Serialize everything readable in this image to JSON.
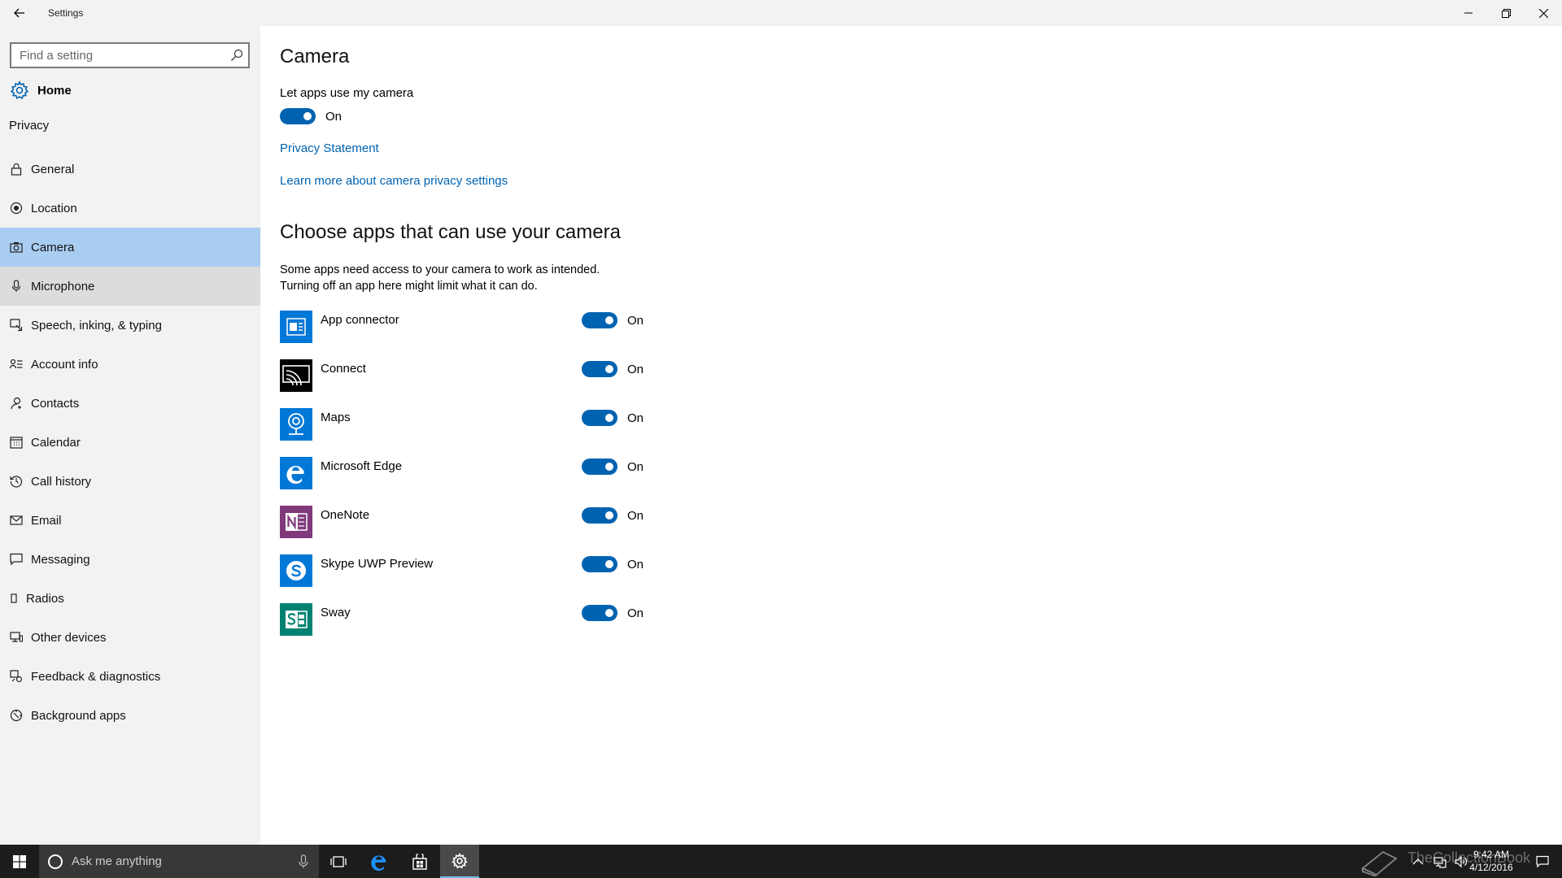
{
  "window": {
    "title": "Settings"
  },
  "sidebar": {
    "search_placeholder": "Find a setting",
    "home_label": "Home",
    "section_label": "Privacy",
    "items": [
      {
        "label": "General",
        "icon": "lock-icon"
      },
      {
        "label": "Location",
        "icon": "location-icon"
      },
      {
        "label": "Camera",
        "icon": "camera-icon",
        "state": "selected"
      },
      {
        "label": "Microphone",
        "icon": "microphone-icon",
        "state": "hover"
      },
      {
        "label": "Speech, inking, & typing",
        "icon": "speech-icon"
      },
      {
        "label": "Account info",
        "icon": "account-info-icon"
      },
      {
        "label": "Contacts",
        "icon": "contacts-icon"
      },
      {
        "label": "Calendar",
        "icon": "calendar-icon"
      },
      {
        "label": "Call history",
        "icon": "history-icon"
      },
      {
        "label": "Email",
        "icon": "email-icon"
      },
      {
        "label": "Messaging",
        "icon": "messaging-icon"
      },
      {
        "label": "Radios",
        "icon": "radios-icon"
      },
      {
        "label": "Other devices",
        "icon": "devices-icon"
      },
      {
        "label": "Feedback & diagnostics",
        "icon": "feedback-icon"
      },
      {
        "label": "Background apps",
        "icon": "background-apps-icon"
      }
    ]
  },
  "main": {
    "title": "Camera",
    "master_toggle": {
      "label": "Let apps use my camera",
      "state": "On"
    },
    "privacy_link": "Privacy Statement",
    "learn_link": "Learn more about camera privacy settings",
    "apps_heading": "Choose apps that can use your camera",
    "description_line1": "Some apps need access to your camera to work as intended.",
    "description_line2": "Turning off an app here might limit what it can do.",
    "apps": [
      {
        "name": "App connector",
        "state": "On",
        "color": "#0078d7",
        "icon": "app-connector-icon"
      },
      {
        "name": "Connect",
        "state": "On",
        "color": "#000000",
        "icon": "connect-icon"
      },
      {
        "name": "Maps",
        "state": "On",
        "color": "#0078d7",
        "icon": "maps-icon"
      },
      {
        "name": "Microsoft Edge",
        "state": "On",
        "color": "#0078d7",
        "icon": "edge-icon"
      },
      {
        "name": "OneNote",
        "state": "On",
        "color": "#80397b",
        "icon": "onenote-icon"
      },
      {
        "name": "Skype UWP Preview",
        "state": "On",
        "color": "#0078d7",
        "icon": "skype-icon"
      },
      {
        "name": "Sway",
        "state": "On",
        "color": "#008272",
        "icon": "sway-icon"
      }
    ]
  },
  "taskbar": {
    "search_placeholder": "Ask me anything",
    "time": "9:42 AM",
    "date": "4/12/2016",
    "watermark": "TheCollectionBook"
  },
  "colors": {
    "accent": "#0063b1",
    "selected": "#a9cdf1",
    "hover": "#dcdcdc",
    "sidebar_bg": "#f2f2f2",
    "taskbar_bg": "#1c1c1c"
  }
}
